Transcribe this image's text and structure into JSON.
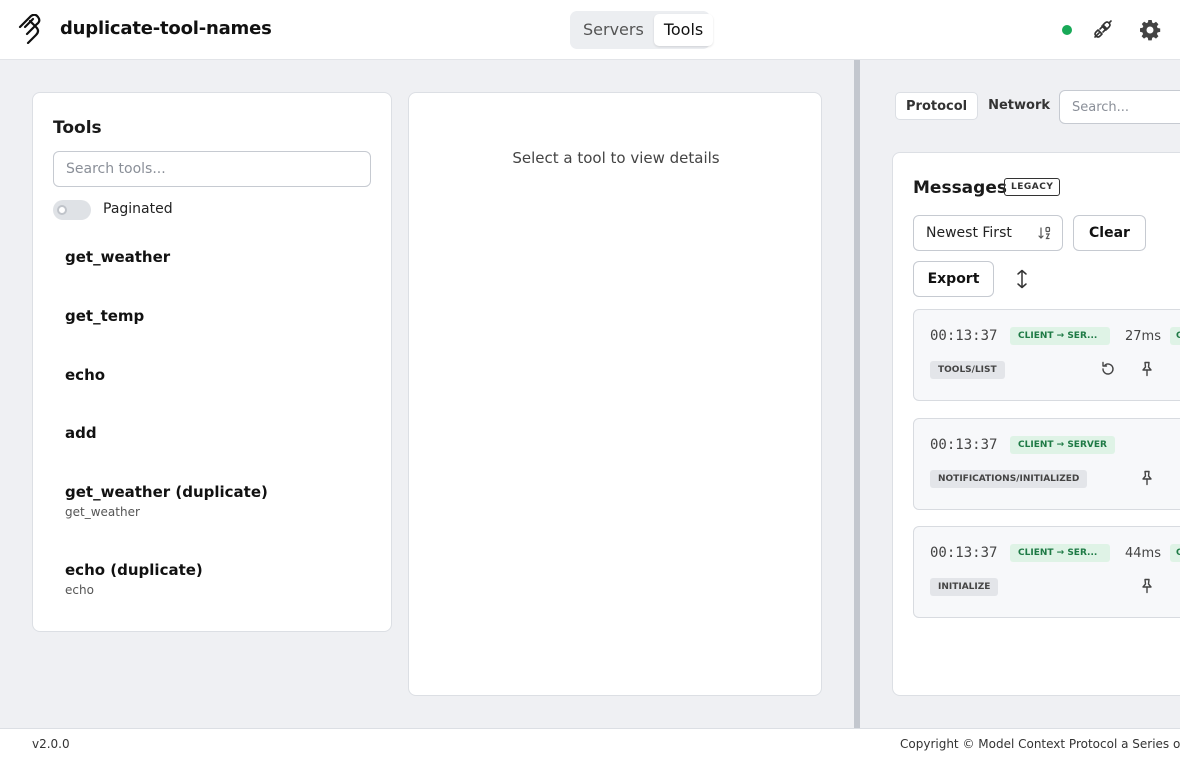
{
  "header": {
    "title": "duplicate-tool-names",
    "tabs": [
      {
        "label": "Servers",
        "active": false
      },
      {
        "label": "Tools",
        "active": true
      }
    ],
    "status_color": "#18a957"
  },
  "tools_panel": {
    "heading": "Tools",
    "search_placeholder": "Search tools...",
    "paginated_label": "Paginated",
    "paginated_on": false,
    "items": [
      {
        "name": "get_weather",
        "sub": ""
      },
      {
        "name": "get_temp",
        "sub": ""
      },
      {
        "name": "echo",
        "sub": ""
      },
      {
        "name": "add",
        "sub": ""
      },
      {
        "name": "get_weather (duplicate)",
        "sub": "get_weather"
      },
      {
        "name": "echo (duplicate)",
        "sub": "echo"
      }
    ]
  },
  "details_panel": {
    "empty_text": "Select a tool to view details"
  },
  "right_panel": {
    "tabs": [
      {
        "label": "Protocol",
        "active": true
      },
      {
        "label": "Network",
        "active": false
      }
    ],
    "search_placeholder": "Search...",
    "messages": {
      "title": "Messages",
      "legacy_badge": "LEGACY",
      "sort_value": "Newest First",
      "clear_label": "Clear",
      "export_label": "Export",
      "cards": [
        {
          "time": "00:13:37",
          "direction": "CLIENT → SER...",
          "latency": "27ms",
          "status": "O",
          "method": "TOOLS/LIST",
          "has_replay": true
        },
        {
          "time": "00:13:37",
          "direction": "CLIENT → SERVER",
          "latency": "",
          "status": "",
          "method": "NOTIFICATIONS/INITIALIZED",
          "has_replay": false
        },
        {
          "time": "00:13:37",
          "direction": "CLIENT → SER...",
          "latency": "44ms",
          "status": "O",
          "method": "INITIALIZE",
          "has_replay": false
        }
      ]
    }
  },
  "footer": {
    "version": "v2.0.0",
    "copyright": "Copyright © Model Context Protocol a Series of LF Projects"
  }
}
